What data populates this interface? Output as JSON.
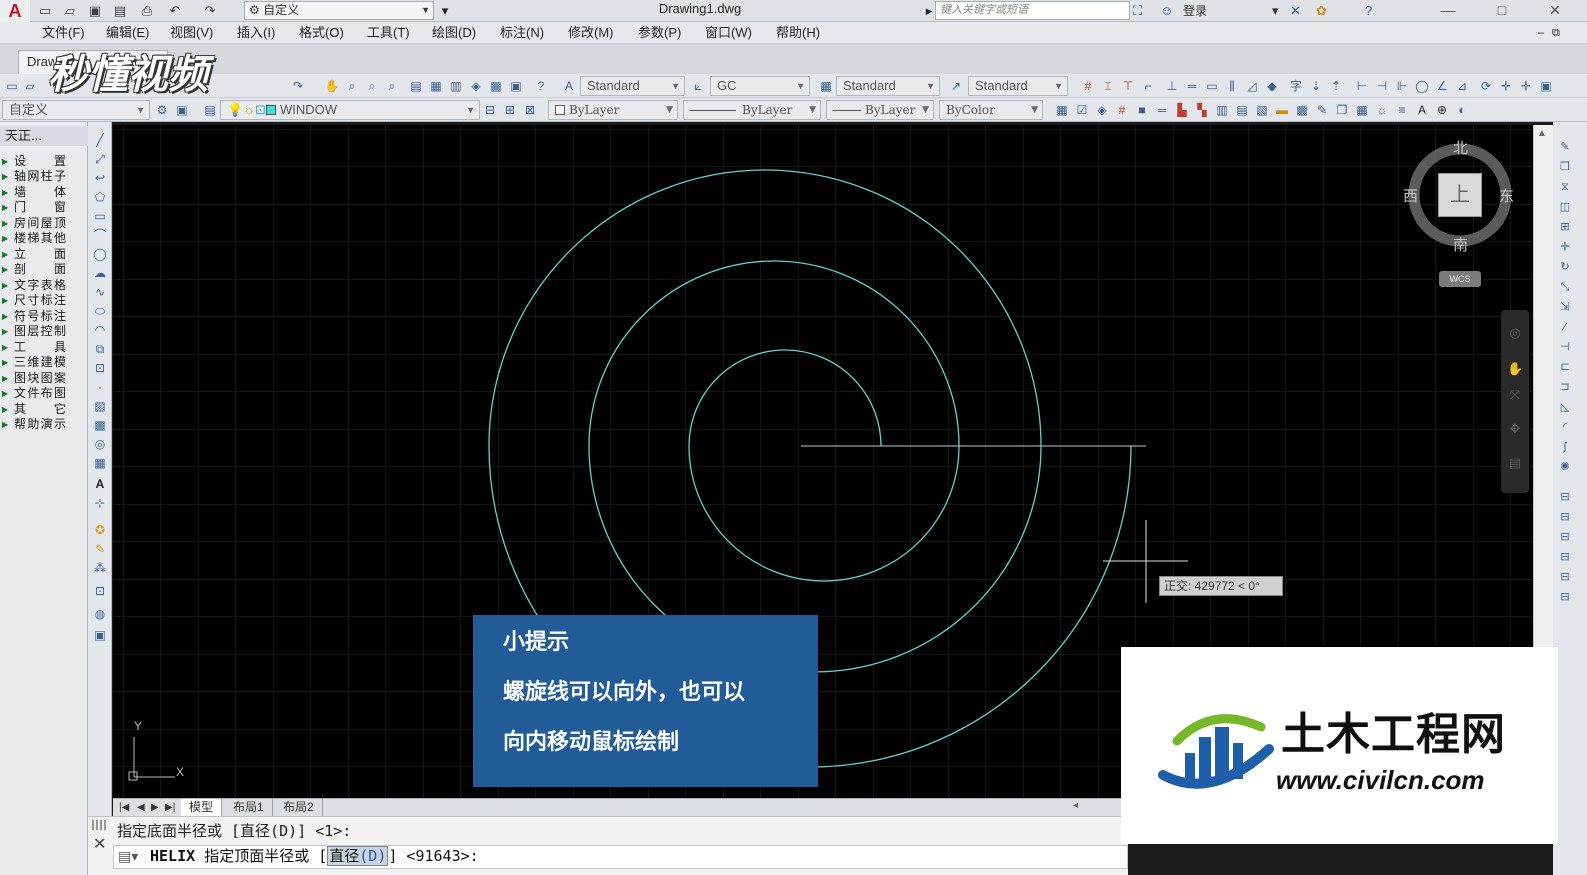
{
  "app": {
    "logo_letter": "A",
    "doc_title": "Drawing1.dwg"
  },
  "workspace": {
    "value": "自定义"
  },
  "search": {
    "placeholder": "键入关键字或短语"
  },
  "account": {
    "login": "登录"
  },
  "window_controls": {
    "minimize": "—",
    "maximize": "□",
    "close": "✕"
  },
  "menu": [
    "文件(F)",
    "编辑(E)",
    "视图(V)",
    "插入(I)",
    "格式(O)",
    "工具(T)",
    "绘图(D)",
    "标注(N)",
    "修改(M)",
    "参数(P)",
    "窗口(W)",
    "帮助(H)"
  ],
  "doc_tab": {
    "label": "Draw"
  },
  "watermark": {
    "text": "秒懂视频"
  },
  "styles": {
    "text_style": "Standard",
    "dim_style": "GC",
    "table_style": "Standard",
    "mleader_style": "Standard"
  },
  "layers": {
    "workspace_combo": "自定义",
    "layer_name": "WINDOW",
    "color": "ByLayer",
    "linetype": "ByLayer",
    "lineweight": "ByLayer",
    "plotstyle": "ByColor"
  },
  "tianzheng": {
    "title": "天正...",
    "items": [
      "设　置",
      "轴网柱子",
      "墙　体",
      "门　窗",
      "房间屋顶",
      "楼梯其他",
      "立　面",
      "剖　面",
      "文字表格",
      "尺寸标注",
      "符号标注",
      "图层控制",
      "工　具",
      "三维建模",
      "图块图案",
      "文件布图",
      "其　它",
      "帮助演示"
    ]
  },
  "canvas": {
    "ucs_y": "Y",
    "ucs_x": "X",
    "compass": {
      "north": "北",
      "south": "南",
      "west": "西",
      "east": "东",
      "top": "上",
      "wcs": "WCS"
    },
    "tooltip": "正交: 429772 < 0°",
    "tip": {
      "title": "小提示",
      "line1": "螺旋线可以向外，也可以",
      "line2": "向内移动鼠标绘制"
    }
  },
  "layout_tabs": [
    "模型",
    "布局1",
    "布局2"
  ],
  "command": {
    "history": "指定底面半径或 [直径(D)] <1>:",
    "prompt_cmd": "HELIX",
    "prompt_text": "指定顶面半径或 [",
    "prompt_opt": "直径",
    "prompt_key": "(D)",
    "prompt_end": "] <91643>:"
  },
  "brand": {
    "name": "土木工程网",
    "url": "www.civilcn.com"
  },
  "colors": {
    "helix": "#5fd3d0",
    "tip_bg": "#215b98",
    "canvas_bg": "#000000"
  }
}
